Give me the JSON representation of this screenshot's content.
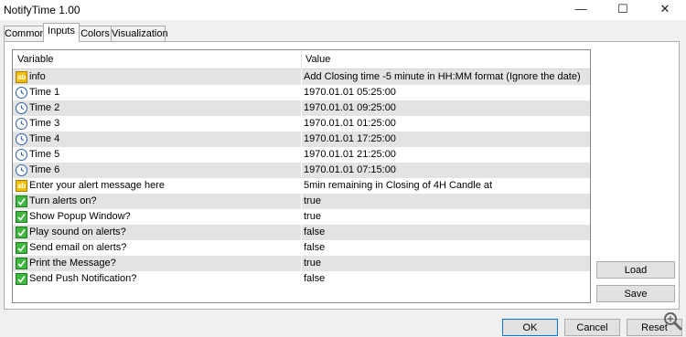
{
  "window": {
    "title": "NotifyTime 1.00",
    "minimize_glyph": "—",
    "maximize_glyph": "☐",
    "close_glyph": "✕"
  },
  "tabs": [
    {
      "label": "Common",
      "active": false
    },
    {
      "label": "Inputs",
      "active": true
    },
    {
      "label": "Colors",
      "active": false
    },
    {
      "label": "Visualization",
      "active": false
    }
  ],
  "table": {
    "headers": {
      "variable": "Variable",
      "value": "Value"
    },
    "rows": [
      {
        "icon": "string-icon",
        "variable": "info",
        "value": "Add Closing time -5 minute in HH:MM format (Ignore the date)"
      },
      {
        "icon": "clock-icon",
        "variable": "Time 1",
        "value": "1970.01.01 05:25:00"
      },
      {
        "icon": "clock-icon",
        "variable": "Time 2",
        "value": "1970.01.01 09:25:00"
      },
      {
        "icon": "clock-icon",
        "variable": "Time 3",
        "value": "1970.01.01 01:25:00"
      },
      {
        "icon": "clock-icon",
        "variable": "Time 4",
        "value": "1970.01.01 17:25:00"
      },
      {
        "icon": "clock-icon",
        "variable": "Time 5",
        "value": "1970.01.01 21:25:00"
      },
      {
        "icon": "clock-icon",
        "variable": "Time 6",
        "value": "1970.01.01 07:15:00"
      },
      {
        "icon": "string-icon",
        "variable": "Enter your alert message here",
        "value": "5min remaining in Closing of 4H Candle at"
      },
      {
        "icon": "boolean-icon",
        "variable": "Turn alerts on?",
        "value": "true"
      },
      {
        "icon": "boolean-icon",
        "variable": "Show Popup Window?",
        "value": "true"
      },
      {
        "icon": "boolean-icon",
        "variable": "Play sound on alerts?",
        "value": "false"
      },
      {
        "icon": "boolean-icon",
        "variable": "Send email on alerts?",
        "value": "false"
      },
      {
        "icon": "boolean-icon",
        "variable": "Print the Message?",
        "value": "true"
      },
      {
        "icon": "boolean-icon",
        "variable": "Send Push Notification?",
        "value": "false"
      }
    ]
  },
  "side_buttons": {
    "load": "Load",
    "save": "Save"
  },
  "footer_buttons": {
    "ok": "OK",
    "cancel": "Cancel",
    "reset": "Reset"
  },
  "colors": {
    "alt_row": "#e3e3e3",
    "accent": "#0078d7"
  }
}
